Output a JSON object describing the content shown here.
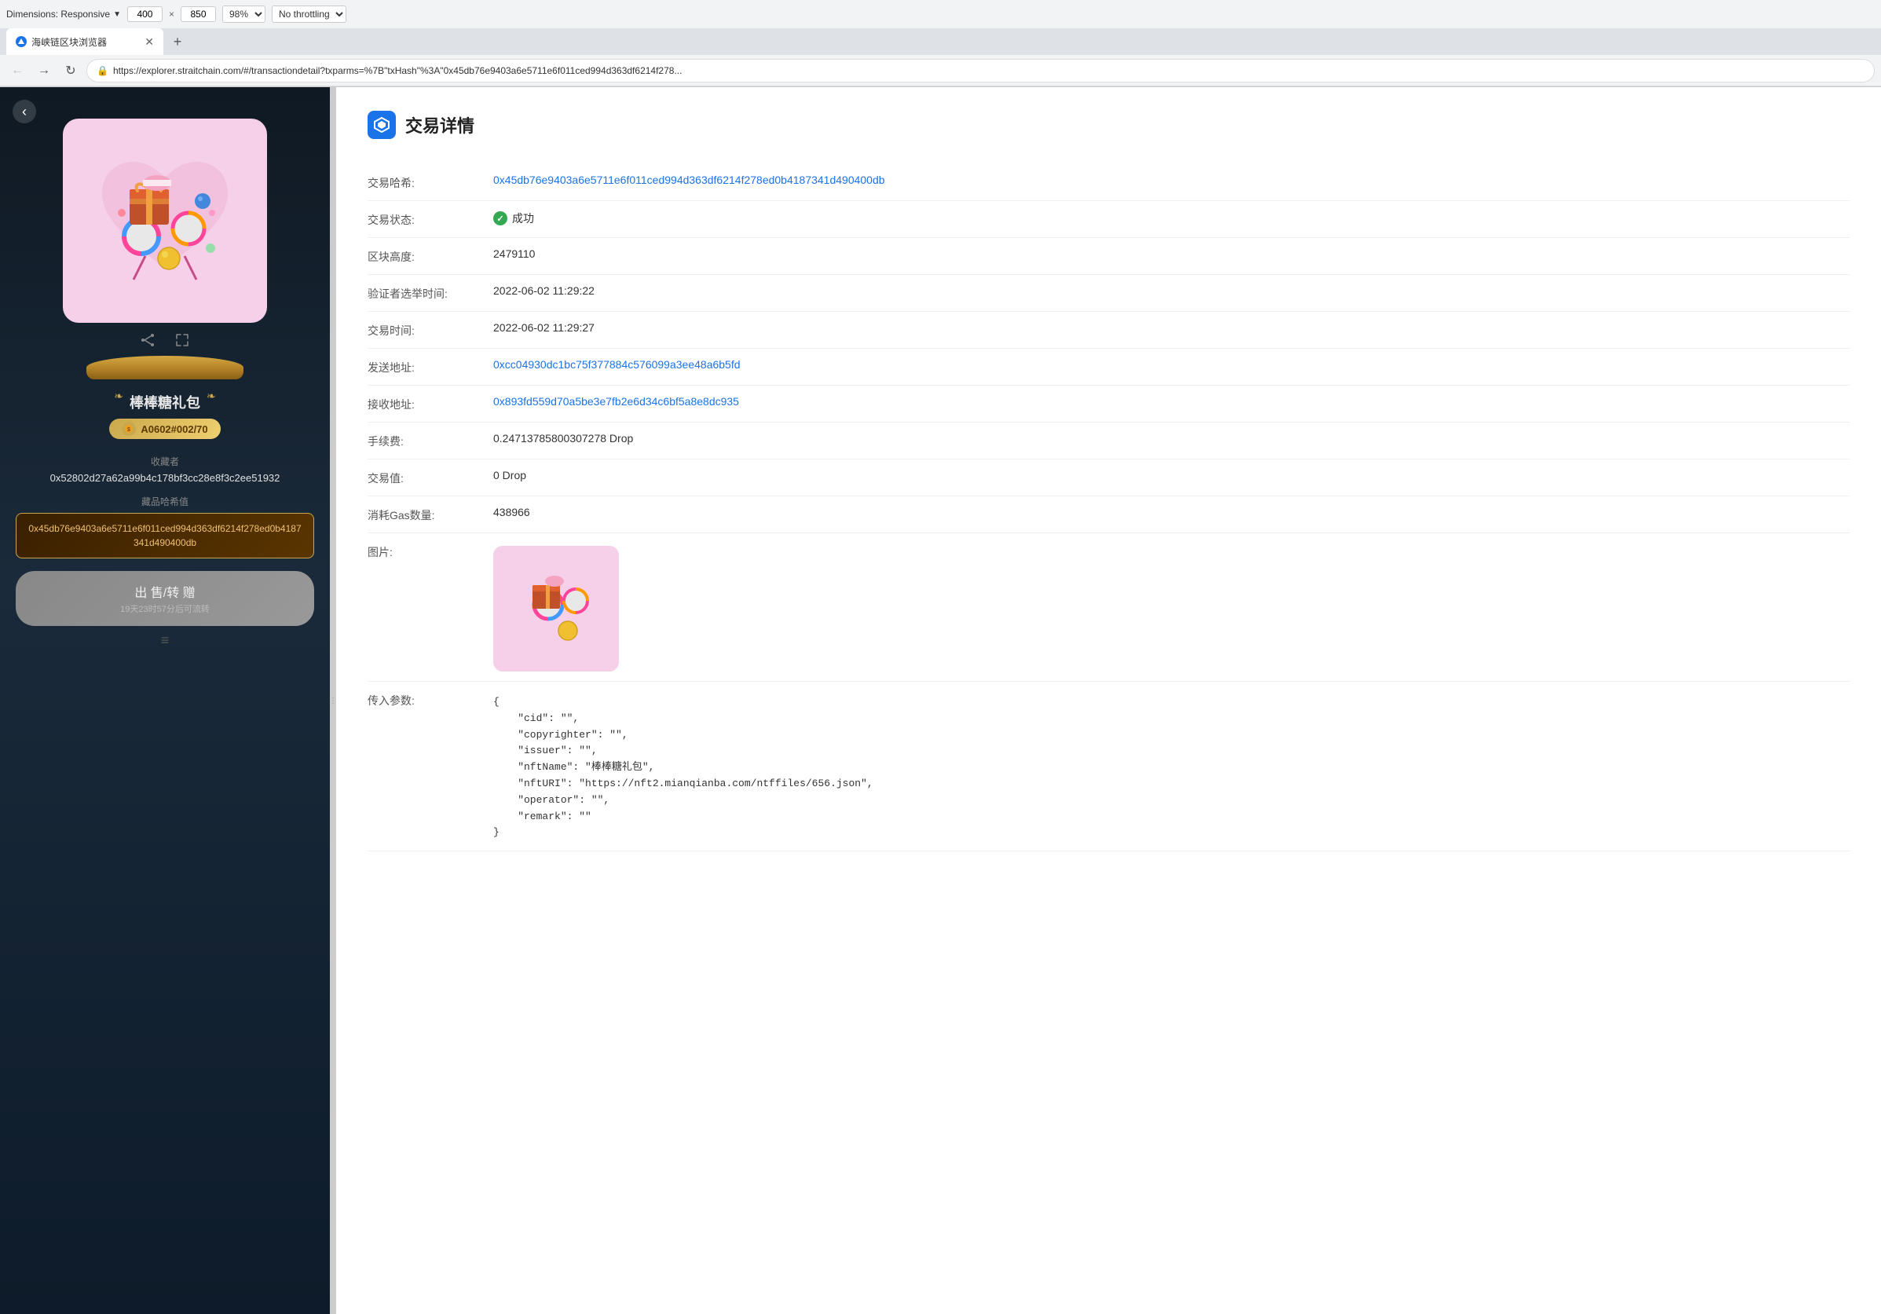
{
  "browser": {
    "toolbar": {
      "responsive_label": "Dimensions: Responsive",
      "width": "400",
      "height": "850",
      "zoom": "98%",
      "throttle": "No throttling"
    },
    "tab": {
      "title": "海峡链区块浏览器",
      "favicon_color": "#1a73e8"
    },
    "new_tab_label": "+",
    "nav": {
      "url": "https://explorer.straitchain.com/#/transactiondetail?txparms=%7B\"txHash\"%3A\"0x45db76e9403a6e5711e6f011ced994d363df6214f278..."
    }
  },
  "left_panel": {
    "back_button": "‹",
    "nft_name": "棒棒糖礼包",
    "badge_text": "A0602#002/70",
    "collector_label": "收藏者",
    "collector_address": "0x52802d27a62a99b4c178bf3cc28e8f3c2ee51932",
    "hash_label": "藏品哈希值",
    "hash_value": "0x45db76e9403a6e5711e6f011ced994d363df6214f278ed0b4187341d490400db",
    "sell_button_text": "出 售/转 赠",
    "sell_button_sub": "19天23时57分后可流转",
    "divider": "≡"
  },
  "right_panel": {
    "page_title": "交易详情",
    "fields": [
      {
        "label": "交易哈希:",
        "value": "0x45db76e9403a6e5711e6f011ced994d363df6214f278ed0b4187341d490400db",
        "type": "link"
      },
      {
        "label": "交易状态:",
        "value": "成功",
        "type": "status"
      },
      {
        "label": "区块高度:",
        "value": "2479110",
        "type": "text"
      },
      {
        "label": "验证者选举时间:",
        "value": "2022-06-02 11:29:22",
        "type": "text"
      },
      {
        "label": "交易时间:",
        "value": "2022-06-02 11:29:27",
        "type": "text"
      },
      {
        "label": "发送地址:",
        "value": "0xcc04930dc1bc75f377884c576099a3ee48a6b5fd",
        "type": "link"
      },
      {
        "label": "接收地址:",
        "value": "0x893fd559d70a5be3e7fb2e6d34c6bf5a8e8dc935",
        "type": "link"
      },
      {
        "label": "手续费:",
        "value": "0.24713785800307278 Drop",
        "type": "text"
      },
      {
        "label": "交易值:",
        "value": "0 Drop",
        "type": "text"
      },
      {
        "label": "消耗Gas数量:",
        "value": "438966",
        "type": "text"
      },
      {
        "label": "图片:",
        "value": "",
        "type": "image"
      },
      {
        "label": "传入参数:",
        "value": "",
        "type": "json"
      }
    ],
    "json_params": "{\n    \"cid\": \"\",\n    \"copyrighter\": \"\",\n    \"issuer\": \"\",\n    \"nftName\": \"棒棒糖礼包\",\n    \"nftURI\": \"https://nft2.mianqianba.com/ntffiles/656.json\",\n    \"operator\": \"\",\n    \"remark\": \"\"\n}"
  }
}
